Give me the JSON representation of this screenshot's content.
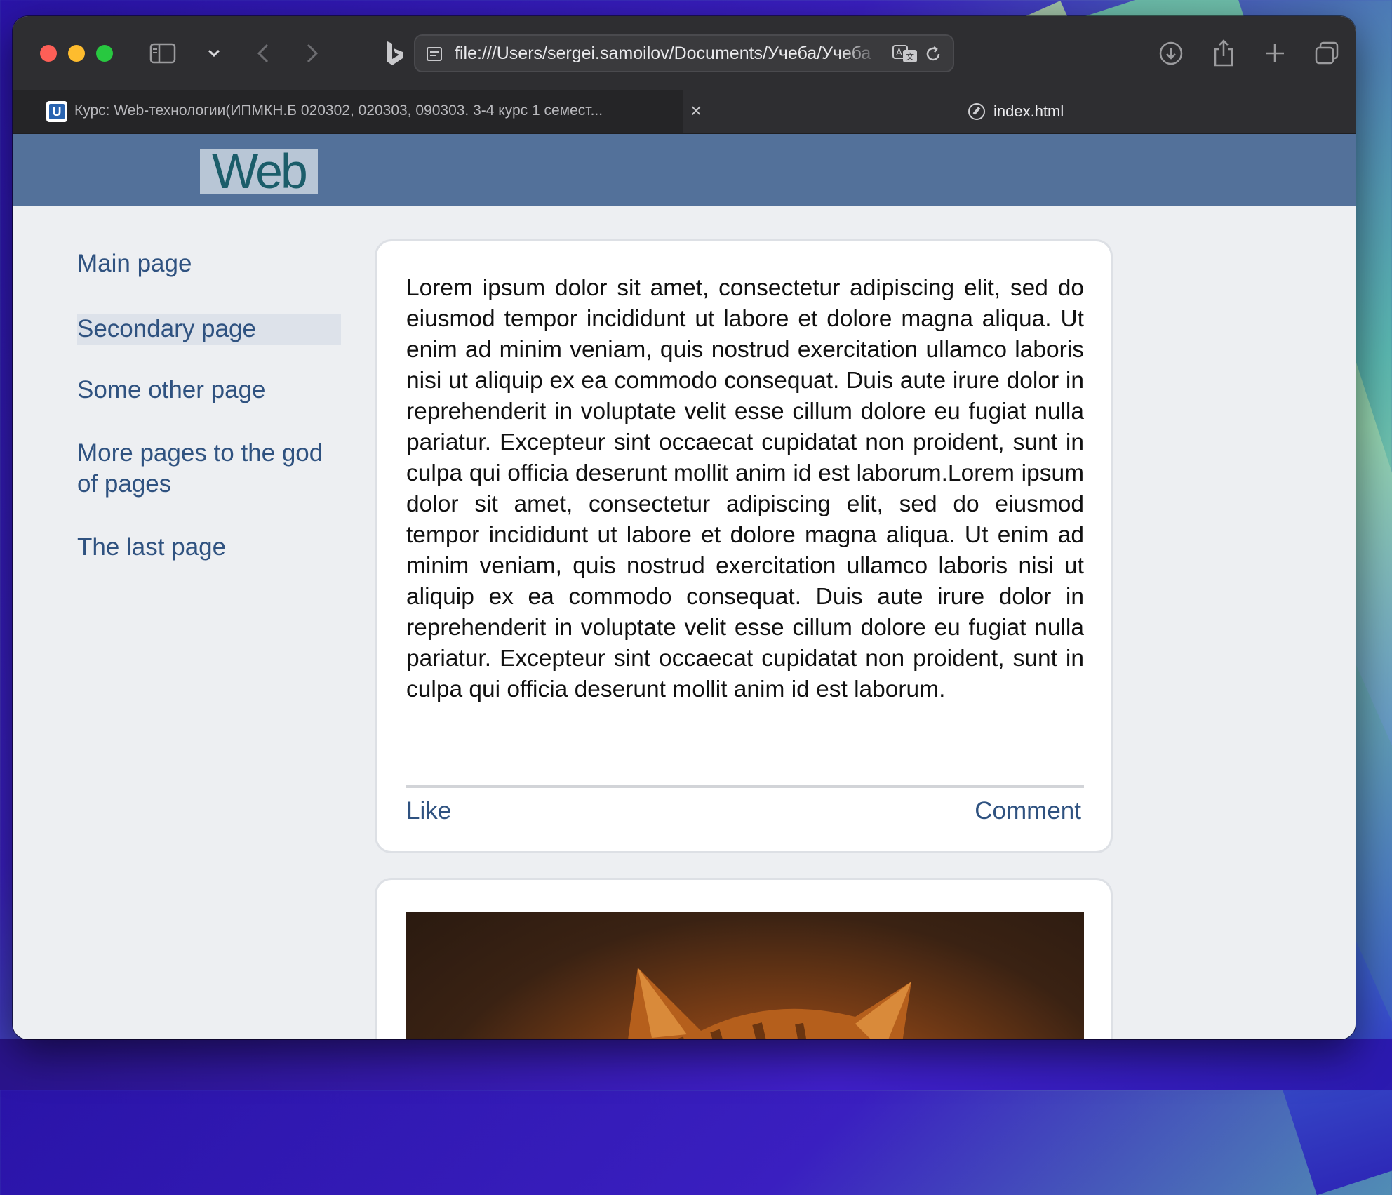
{
  "browser": {
    "url": "file:///Users/sergei.samoilov/Documents/Учеба/Учеба",
    "tabs": [
      {
        "title": "Курс: Web-технологии(ИПМКН.Б 020302, 020303, 090303. 3-4 курс 1 семест...",
        "favicon": "U"
      },
      {
        "title": "index.html"
      }
    ],
    "icons": [
      "sidebar-toggle-icon",
      "chevron-down-icon",
      "back-icon",
      "forward-icon",
      "bing-icon",
      "page-settings-icon",
      "translate-icon",
      "reload-icon",
      "download-icon",
      "share-icon",
      "new-tab-icon",
      "tab-overview-icon",
      "close-tab-icon",
      "compass-icon"
    ]
  },
  "site": {
    "logo": "Web",
    "nav": [
      {
        "label": "Main page",
        "selected": false
      },
      {
        "label": "Secondary page",
        "selected": true
      },
      {
        "label": "Some other page",
        "selected": false
      },
      {
        "label": "More pages to the god of pages",
        "selected": false
      },
      {
        "label": "The last page",
        "selected": false
      }
    ],
    "posts": [
      {
        "text": "Lorem ipsum dolor sit amet, consectetur adipiscing elit, sed do eiusmod tempor incididunt ut labore et dolore magna aliqua. Ut enim ad minim veniam, quis nostrud exercitation ullamco laboris nisi ut aliquip ex ea commodo consequat. Duis aute irure dolor in reprehenderit in voluptate velit esse cillum dolore eu fugiat nulla pariatur. Excepteur sint occaecat cupidatat non proident, sunt in culpa qui officia deserunt mollit anim id est laborum.Lorem ipsum dolor sit amet, consectetur adipiscing elit, sed do eiusmod tempor incididunt ut labore et dolore magna aliqua. Ut enim ad minim veniam, quis nostrud exercitation ullamco laboris nisi ut aliquip ex ea commodo consequat. Duis aute irure dolor in reprehenderit in voluptate velit esse cillum dolore eu fugiat nulla pariatur. Excepteur sint occaecat cupidatat non proident, sunt in culpa qui officia deserunt mollit anim id est laborum.",
        "like_label": "Like",
        "comment_label": "Comment"
      }
    ]
  },
  "colors": {
    "header": "#53719a",
    "link": "#2f5280",
    "page_bg": "#edeff2",
    "chrome": "#2e2e31"
  }
}
